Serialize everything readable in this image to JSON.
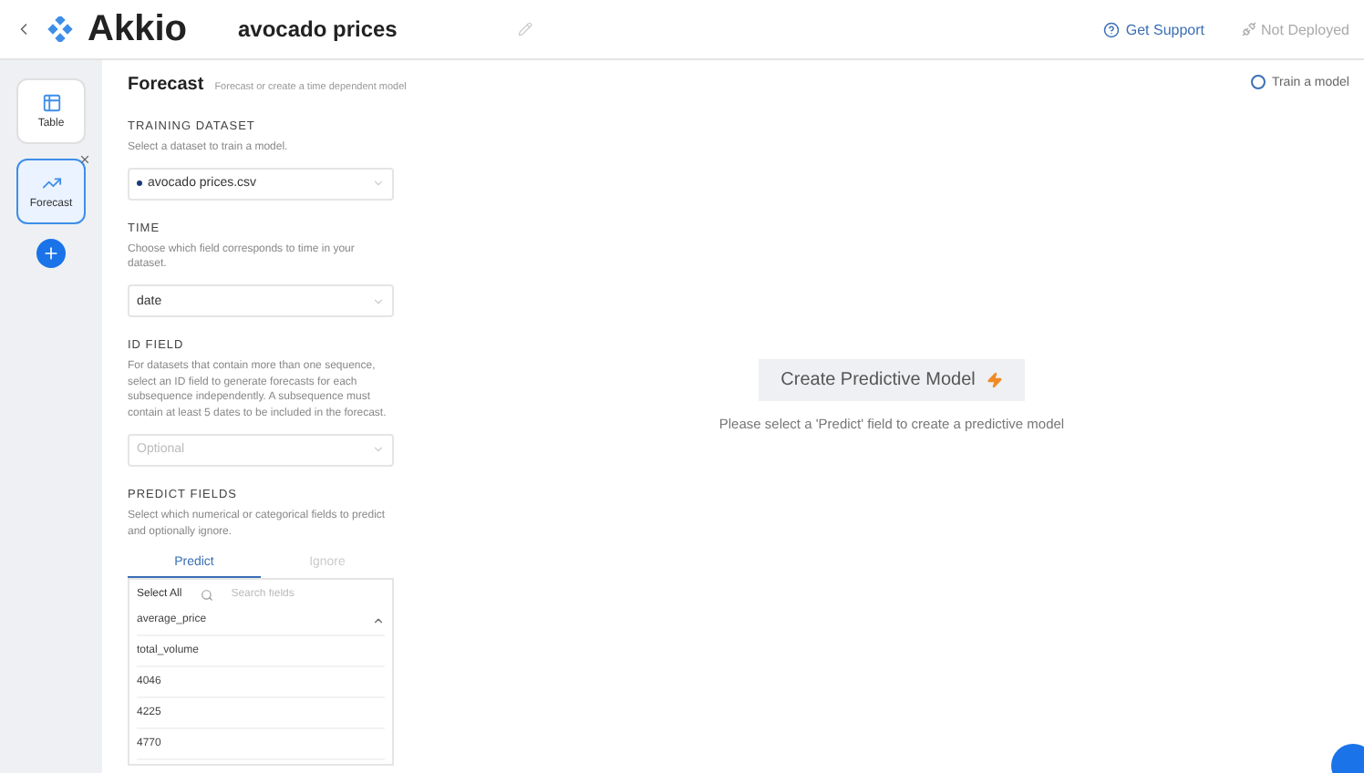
{
  "header": {
    "logo": "Akkio",
    "project": "avocado prices",
    "support": "Get Support",
    "deploy_status": "Not Deployed"
  },
  "sidebar": {
    "items": [
      {
        "label": "Table",
        "kind": "table",
        "selected": false,
        "closable": false
      },
      {
        "label": "Forecast",
        "kind": "forecast",
        "selected": true,
        "closable": true
      }
    ]
  },
  "page": {
    "title": "Forecast",
    "subtitle": "Forecast or create a time dependent model",
    "status": "Train a model"
  },
  "sections": [
    {
      "heading": "TRAINING DATASET",
      "description": "Select a dataset to train a model.",
      "select": {
        "value": "avocado prices.csv",
        "dot": true
      }
    },
    {
      "heading": "TIME",
      "description": "Choose which field corresponds to time in your dataset.",
      "select": {
        "value": "date",
        "dot": false
      }
    },
    {
      "heading": "ID FIELD",
      "description": "For datasets that contain more than one sequence, select an ID field to generate forecasts for each subsequence independently. A subsequence must contain at least 5 dates to be included in the forecast.",
      "select": {
        "placeholder": "Optional"
      }
    },
    {
      "heading": "PREDICT FIELDS",
      "description": "Select which numerical or categorical fields to predict and optionally ignore."
    }
  ],
  "predict_tabs": [
    {
      "label": "Predict",
      "selected": true
    },
    {
      "label": "Ignore",
      "selected": false
    }
  ],
  "field_list": {
    "select_all": "Select All",
    "search_placeholder": "Search fields",
    "fields": [
      "average_price",
      "total_volume",
      "4046",
      "4225",
      "4770"
    ]
  },
  "main": {
    "button": "Create Predictive Model",
    "hint": "Please select a 'Predict' field to create a predictive model"
  }
}
